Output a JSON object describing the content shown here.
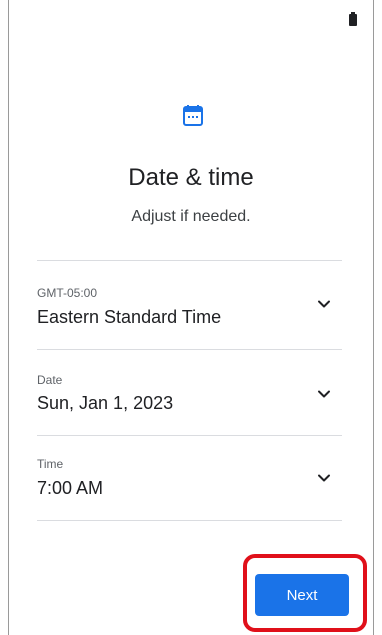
{
  "header": {
    "title": "Date & time",
    "subtitle": "Adjust if needed."
  },
  "settings": [
    {
      "label": "GMT-05:00",
      "value": "Eastern Standard Time"
    },
    {
      "label": "Date",
      "value": "Sun, Jan 1, 2023"
    },
    {
      "label": "Time",
      "value": "7:00 AM"
    }
  ],
  "footer": {
    "next_label": "Next"
  },
  "colors": {
    "accent": "#1a73e8",
    "highlight": "#e0101a"
  },
  "icons": {
    "header": "calendar-icon",
    "row_action": "chevron-down-icon",
    "status": "battery-icon"
  }
}
